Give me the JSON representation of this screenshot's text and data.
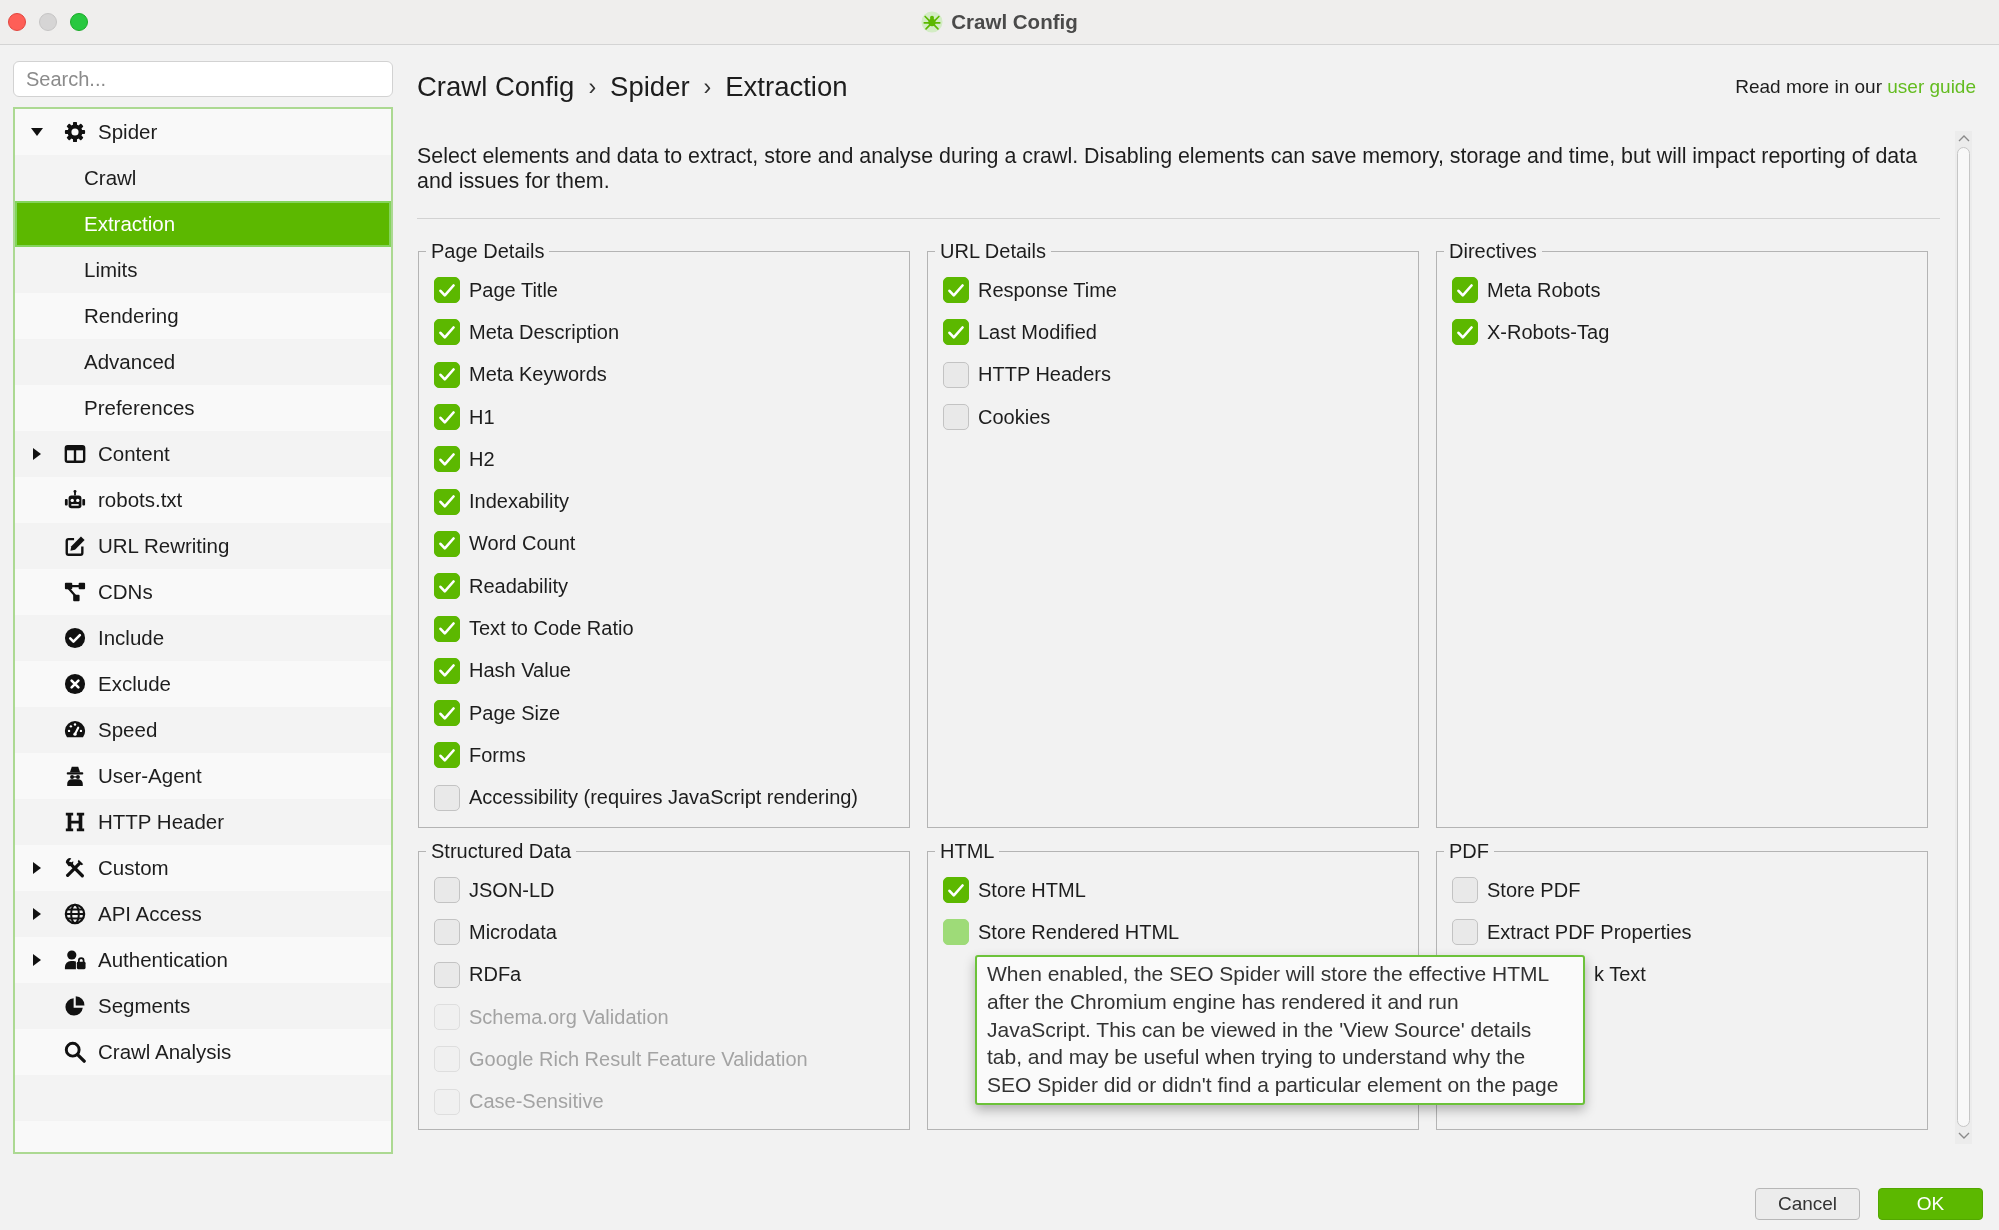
{
  "window": {
    "title": "Crawl Config",
    "controls": [
      {
        "kind": "close",
        "disabled": false
      },
      {
        "kind": "minimize",
        "disabled": true
      },
      {
        "kind": "zoom",
        "disabled": false
      }
    ]
  },
  "sidebar": {
    "search": {
      "placeholder": "Search..."
    },
    "items": [
      {
        "label": "Spider",
        "selected": false,
        "expanded": true,
        "children": [
          {
            "label": "Crawl",
            "selected": false
          },
          {
            "label": "Extraction",
            "selected": true
          },
          {
            "label": "Limits",
            "selected": false
          },
          {
            "label": "Rendering",
            "selected": false
          },
          {
            "label": "Advanced",
            "selected": false
          },
          {
            "label": "Preferences",
            "selected": false
          }
        ]
      },
      {
        "label": "Content",
        "selected": false,
        "expanded": false
      },
      {
        "label": "robots.txt",
        "selected": false
      },
      {
        "label": "URL Rewriting",
        "selected": false
      },
      {
        "label": "CDNs",
        "selected": false
      },
      {
        "label": "Include",
        "selected": false
      },
      {
        "label": "Exclude",
        "selected": false
      },
      {
        "label": "Speed",
        "selected": false
      },
      {
        "label": "User-Agent",
        "selected": false
      },
      {
        "label": "HTTP Header",
        "selected": false
      },
      {
        "label": "Custom",
        "selected": false,
        "expanded": false
      },
      {
        "label": "API Access",
        "selected": false,
        "expanded": false
      },
      {
        "label": "Authentication",
        "selected": false,
        "expanded": false
      },
      {
        "label": "Segments",
        "selected": false
      },
      {
        "label": "Crawl Analysis",
        "selected": false
      }
    ]
  },
  "breadcrumb": [
    {
      "kind": "crumb",
      "text": "Crawl Config"
    },
    {
      "kind": "separator",
      "text": "›"
    },
    {
      "kind": "crumb",
      "text": "Spider"
    },
    {
      "kind": "separator",
      "text": "›"
    },
    {
      "kind": "crumb",
      "text": "Extraction"
    }
  ],
  "help": {
    "text": "Read more in our",
    "link": "user guide"
  },
  "description": "Select elements and data to extract, store and analyse during a crawl. Disabling elements can save memory, storage and time, but will impact reporting of data and issues for them.",
  "groups": [
    {
      "title": "Page Details",
      "items": [
        {
          "label": "Page Title",
          "checked": true
        },
        {
          "label": "Meta Description",
          "checked": true
        },
        {
          "label": "Meta Keywords",
          "checked": true
        },
        {
          "label": "H1",
          "checked": true
        },
        {
          "label": "H2",
          "checked": true
        },
        {
          "label": "Indexability",
          "checked": true
        },
        {
          "label": "Word Count",
          "checked": true
        },
        {
          "label": "Readability",
          "checked": true
        },
        {
          "label": "Text to Code Ratio",
          "checked": true
        },
        {
          "label": "Hash Value",
          "checked": true
        },
        {
          "label": "Page Size",
          "checked": true
        },
        {
          "label": "Forms",
          "checked": true
        },
        {
          "label": "Accessibility (requires JavaScript rendering)",
          "checked": false
        }
      ]
    },
    {
      "title": "URL Details",
      "items": [
        {
          "label": "Response Time",
          "checked": true
        },
        {
          "label": "Last Modified",
          "checked": true
        },
        {
          "label": "HTTP Headers",
          "checked": false
        },
        {
          "label": "Cookies",
          "checked": false
        }
      ]
    },
    {
      "title": "Directives",
      "items": [
        {
          "label": "Meta Robots",
          "checked": true
        },
        {
          "label": "X-Robots-Tag",
          "checked": true
        }
      ]
    },
    {
      "title": "Structured Data",
      "items": [
        {
          "label": "JSON-LD",
          "checked": false,
          "disabled": false
        },
        {
          "label": "Microdata",
          "checked": false,
          "disabled": false
        },
        {
          "label": "RDFa",
          "checked": false,
          "disabled": false
        },
        {
          "label": "Schema.org Validation",
          "checked": false,
          "disabled": true
        },
        {
          "label": "Google Rich Result Feature Validation",
          "checked": false,
          "disabled": true
        },
        {
          "label": "Case-Sensitive",
          "checked": false,
          "disabled": true
        }
      ]
    },
    {
      "title": "HTML",
      "items": [
        {
          "label": "Store HTML",
          "checked": true
        },
        {
          "label": "Store Rendered HTML",
          "checked": false,
          "hovered": true,
          "tooltip": "When enabled, the SEO Spider will store the effective HTML\nafter the Chromium engine has rendered it and run\nJavaScript. This can be viewed in the 'View Source' details\ntab, and may be useful when trying to understand why the\nSEO Spider did or didn't find a particular element on the page"
        }
      ]
    },
    {
      "title": "PDF",
      "items": [
        {
          "kind": "check",
          "label": "Store PDF",
          "checked": false
        },
        {
          "kind": "check",
          "label": "Extract PDF Properties",
          "checked": false
        },
        {
          "kind": "covered",
          "label": "k Text"
        }
      ]
    }
  ],
  "buttons": [
    {
      "kind": "secondary",
      "label": "Cancel"
    },
    {
      "kind": "primary",
      "label": "OK"
    }
  ]
}
